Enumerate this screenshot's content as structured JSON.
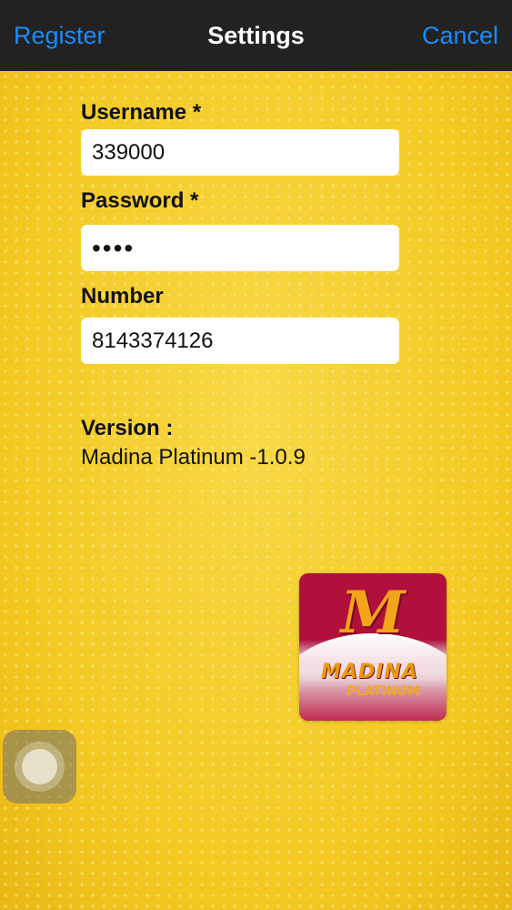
{
  "navbar": {
    "left_label": "Register",
    "title": "Settings",
    "right_label": "Cancel"
  },
  "form": {
    "username": {
      "label": "Username *",
      "value": "339000"
    },
    "password": {
      "label": "Password *",
      "value": "••••"
    },
    "number": {
      "label": "Number",
      "value": "8143374126"
    }
  },
  "version": {
    "label": "Version :",
    "value": "Madina Platinum -1.0.9"
  },
  "logo": {
    "monogram": "M",
    "name": "MADINA",
    "subtitle": "PLATINUM"
  },
  "colors": {
    "navbar_bg": "#222222",
    "nav_link": "#1a8cff",
    "background": "#f6cf2a",
    "logo_red": "#b0103b",
    "logo_orange": "#f4a419"
  }
}
